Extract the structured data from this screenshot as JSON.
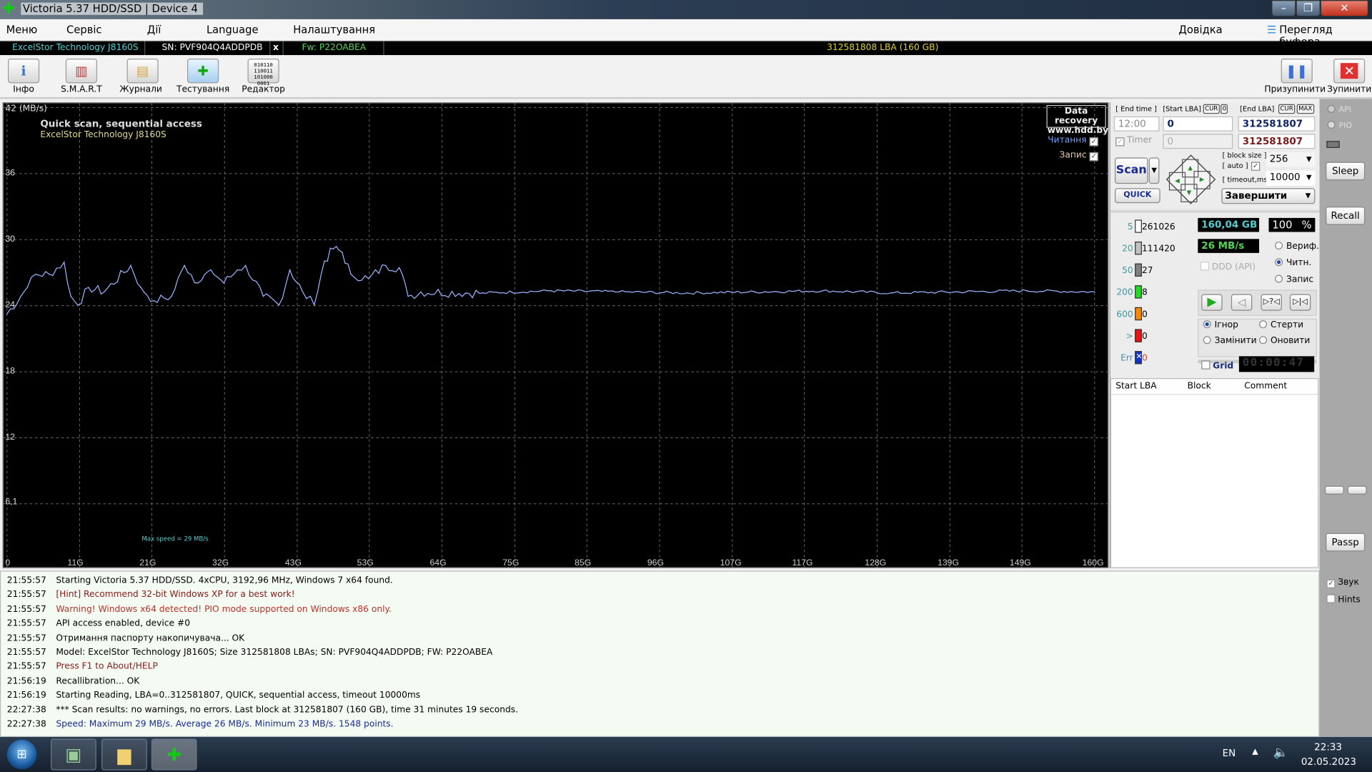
{
  "window": {
    "title": "Victoria 5.37 HDD/SSD | Device 4",
    "minimize": "–",
    "maximize": "❐",
    "close": "✕"
  },
  "menu": {
    "items": [
      "Меню",
      "Сервіс",
      "Дії",
      "Language",
      "Налаштування"
    ],
    "help": "Довідка",
    "buffer": "Перегляд буфера"
  },
  "device": {
    "model": "ExcelStor Technology J8160S",
    "sn": "SN: PVF904Q4ADDPDB",
    "close": "x",
    "fw": "Fw: P22OABEA",
    "lba": "312581808 LBA (160 GB)"
  },
  "toolbar": {
    "buttons": [
      {
        "label": "Інфо",
        "icon": "info-icon"
      },
      {
        "label": "S.M.A.R.T",
        "icon": "smart-icon"
      },
      {
        "label": "Журнали",
        "icon": "logs-folder-icon"
      },
      {
        "label": "Тестування",
        "icon": "test-kit-icon"
      },
      {
        "label": "Редактор",
        "icon": "binary-editor-icon"
      }
    ],
    "pause": "Призупинити",
    "stop": "Зупинити"
  },
  "chart_data": {
    "type": "line",
    "title": "Quick scan, sequential access",
    "subtitle": "ExcelStor Technology J8160S",
    "ylabel": "(MB/s)",
    "ylim": [
      0,
      42
    ],
    "xlim": [
      0,
      160
    ],
    "yticks": [
      "42",
      "36",
      "30",
      "24",
      "18",
      "12",
      "6,1"
    ],
    "ytick_values": [
      42,
      36,
      30,
      24,
      18,
      12,
      6.1
    ],
    "xticks": [
      "0",
      "11G",
      "21G",
      "32G",
      "43G",
      "53G",
      "64G",
      "75G",
      "85G",
      "96G",
      "107G",
      "117G",
      "128G",
      "139G",
      "149G",
      "160G"
    ],
    "xtick_values": [
      0,
      10.7,
      21.3,
      32,
      42.7,
      53.3,
      64,
      74.7,
      85.3,
      96,
      106.7,
      117.3,
      128,
      138.7,
      149.3,
      160
    ],
    "grid": true,
    "annotation": "Max speed = 29 MB/s",
    "legend": [
      {
        "label": "Читання",
        "checked": true,
        "color": "#6fa0ff"
      },
      {
        "label": "Запис",
        "checked": true,
        "color": "#e8c8a8"
      }
    ],
    "watermark": [
      "Data recovery",
      "www.hdd.by"
    ],
    "series": [
      {
        "color": "#9ab4ff",
        "x": [
          0,
          3.0,
          4.2,
          6.2,
          8.4,
          9.4,
          10.4,
          12.0,
          14.3,
          18.2,
          19.7,
          21.6,
          24.2,
          26.1,
          28.1,
          30.0,
          31.9,
          33.9,
          35.1,
          37.7,
          40.0,
          41.6,
          43.5,
          45.2,
          46.7,
          48.0,
          49.3,
          50.6,
          53.2,
          55.7,
          57.7,
          59.0,
          60.9,
          70,
          80,
          90,
          100,
          110,
          120,
          130,
          140,
          150,
          160
        ],
        "y": [
          23.1,
          25.5,
          26.7,
          26.7,
          27.8,
          24.7,
          23.9,
          25.5,
          25.1,
          27.5,
          25.5,
          24.3,
          24.7,
          27.5,
          25.9,
          27.1,
          25.9,
          27.1,
          27.5,
          24.7,
          23.9,
          27.1,
          25.1,
          23.9,
          27.9,
          29.0,
          28.7,
          26.7,
          26.3,
          27.5,
          27.3,
          24.7,
          25.1,
          25.0,
          25.2,
          25.1,
          25.0,
          25.1,
          25.2,
          25.0,
          25.1,
          25.2,
          25.1
        ]
      }
    ]
  },
  "controls": {
    "end_time_label": "[ End time ]",
    "start_lba_label": "[Start LBA]",
    "cur": "CUR",
    "zero": "0",
    "end_lba_label": "[End LBA]",
    "max": "MAX",
    "end_time": "12:00",
    "start_lba": "0",
    "end_lba": "312581807",
    "timer_label": "Timer",
    "timer_value": "0",
    "end_lba2": "312581807",
    "scan": "Scan",
    "quick": "QUICK",
    "block_size_label": "[ block size ]",
    "auto_label": "[ auto ]",
    "block_size": "256",
    "timeout_label": "[ timeout,ms ]",
    "timeout": "10000",
    "finish": "Завершити"
  },
  "stats": {
    "rows": [
      {
        "n": "5",
        "v": "261026",
        "color": "#ffffff"
      },
      {
        "n": "20",
        "v": "111420",
        "color": "#c0c0c0"
      },
      {
        "n": "50",
        "v": "27",
        "color": "#808080"
      },
      {
        "n": "200",
        "v": "8",
        "color": "#22dd22"
      },
      {
        "n": "600",
        "v": "0",
        "color": "#ff8800"
      },
      {
        "n": ">",
        "v": "0",
        "color": "#ee1111"
      },
      {
        "n": "Err",
        "v": "0",
        "color": "#1133cc"
      }
    ],
    "size": "160,04 GB",
    "percent": "100",
    "percent_sign": "%",
    "speed": "26 MB/s",
    "ddd": "DDD (API)",
    "modes": [
      "Вериф.",
      "Читн.",
      "Запис"
    ],
    "mode_selected": "Читн.",
    "actions": [
      "Ігнор",
      "Стерти",
      "Замінити",
      "Оновити"
    ],
    "action_selected": "Ігнор",
    "grid": "Grid",
    "elapsed": "00:00:47"
  },
  "table": {
    "headers": [
      "Start LBA",
      "Block",
      "Comment"
    ]
  },
  "side": {
    "api": "API",
    "pio": "PIO",
    "sleep": "Sleep",
    "recall": "Recall",
    "passp": "Passp",
    "sound": "Звук",
    "hints": "Hints"
  },
  "log": [
    {
      "t": "21:55:57",
      "m": "Starting Victoria 5.37 HDD/SSD. 4xCPU, 3192,96 MHz, Windows 7 x64 found.",
      "c": "#000000"
    },
    {
      "t": "21:55:57",
      "m": "[Hint] Recommend 32-bit Windows XP for a best work!",
      "c": "#8b1a1a"
    },
    {
      "t": "21:55:57",
      "m": "Warning! Windows x64 detected! PIO mode supported on Windows x86 only.",
      "c": "#c0302a"
    },
    {
      "t": "21:55:57",
      "m": "API access enabled, device #0",
      "c": "#000000"
    },
    {
      "t": "21:55:57",
      "m": "Отримання паспорту накопичувача... OK",
      "c": "#000000"
    },
    {
      "t": "21:55:57",
      "m": "Model: ExcelStor Technology J8160S; Size 312581808 LBAs; SN: PVF904Q4ADDPDB; FW: P22OABEA",
      "c": "#000000"
    },
    {
      "t": "21:55:57",
      "m": "Press F1 to About/HELP",
      "c": "#8b1a1a"
    },
    {
      "t": "21:56:19",
      "m": "Recallibration... OK",
      "c": "#000000"
    },
    {
      "t": "21:56:19",
      "m": "Starting Reading, LBA=0..312581807, QUICK, sequential access, timeout 10000ms",
      "c": "#000000"
    },
    {
      "t": "22:27:38",
      "m": "*** Scan results: no warnings, no errors. Last block at 312581807 (160 GB), time 31 minutes 19 seconds.",
      "c": "#000000"
    },
    {
      "t": "22:27:38",
      "m": "Speed: Maximum 29 MB/s. Average 26 MB/s. Minimum 23 MB/s. 1548 points.",
      "c": "#1a2a9a"
    }
  ],
  "taskbar": {
    "lang": "EN",
    "time": "22:33",
    "date": "02.05.2023"
  }
}
